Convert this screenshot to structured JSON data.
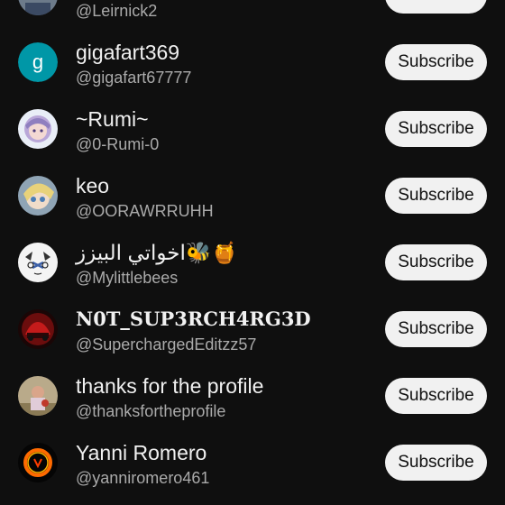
{
  "channels": [
    {
      "name": "",
      "handle": "@Leirnick2",
      "subscribe_label": "Subscribe",
      "avatar_icon": "user-avatar-photo"
    },
    {
      "name": "gigafart369",
      "handle": "@gigafart67777",
      "subscribe_label": "Subscribe",
      "avatar_letter": "g",
      "avatar_color": "#0097a7"
    },
    {
      "name": "~Rumi~",
      "handle": "@0-Rumi-0",
      "subscribe_label": "Subscribe",
      "avatar_icon": "anime-girl-avatar"
    },
    {
      "name": "keo",
      "handle": "@OORAWRRUHH",
      "subscribe_label": "Subscribe",
      "avatar_icon": "anime-avatar"
    },
    {
      "name": "اخواتي البيزز🐝🍯",
      "handle": "@Mylittlebees",
      "subscribe_label": "Subscribe",
      "avatar_icon": "sketch-face-avatar"
    },
    {
      "name": "N0T_SUP3RCH4RG3D",
      "handle": "@SuperchargedEditzz57",
      "subscribe_label": "Subscribe",
      "avatar_icon": "red-car-avatar"
    },
    {
      "name": "thanks for the profile",
      "handle": "@thanksfortheprofile",
      "subscribe_label": "Subscribe",
      "avatar_icon": "photo-avatar"
    },
    {
      "name": "Yanni Romero",
      "handle": "@yanniromero461",
      "subscribe_label": "Subscribe",
      "avatar_icon": "fire-ring-avatar"
    }
  ],
  "colors": {
    "background": "#0f0f0f",
    "button": "#f1f1f1",
    "handle_text": "#aaaaaa"
  }
}
